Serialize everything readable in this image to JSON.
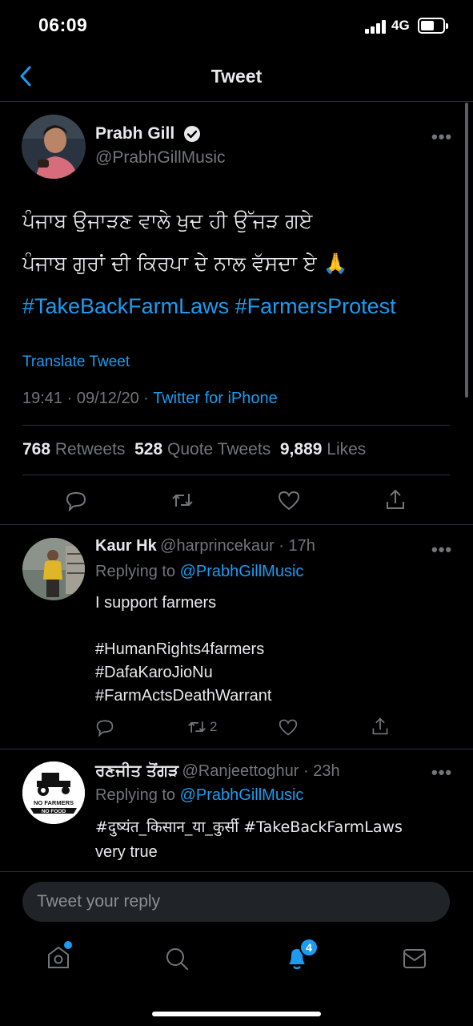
{
  "status_bar": {
    "time": "06:09",
    "network": "4G",
    "battery_level": 0.62
  },
  "header": {
    "title": "Tweet",
    "back_icon": "chevron-left-icon"
  },
  "tweet": {
    "author_name": "Prabh Gill",
    "verified": true,
    "handle": "@PrabhGillMusic",
    "text_line1": "ਪੰਜਾਬ ਉਜਾੜਣ ਵਾਲੇ ਖੁਦ ਹੀ ਉੱਜੜ ਗਏ",
    "text_line2": "ਪੰਜਾਬ ਗੁਰਾਂ ਦੀ ਕਿਰਪਾ ਦੇ ਨਾਲ ਵੱਸਦਾ ਏ",
    "emoji": "🙏",
    "hashtags": "#TakeBackFarmLaws #FarmersProtest",
    "translate_label": "Translate Tweet",
    "time": "19:41",
    "date": "09/12/20",
    "source": "Twitter for iPhone",
    "retweets_count": "768",
    "retweets_label": "Retweets",
    "quotes_count": "528",
    "quotes_label": "Quote Tweets",
    "likes_count": "9,889",
    "likes_label": "Likes"
  },
  "replies": [
    {
      "name": "Kaur Hk",
      "handle": "@harprincekaur",
      "time": "17h",
      "replying_prefix": "Replying to",
      "replying_to": "@PrabhGillMusic",
      "text": "I support farmers",
      "hashtags": [
        "#HumanRights4farmers",
        "#DafaKaroJioNu",
        "#FarmActsDeathWarrant"
      ],
      "retweet_count": "2"
    },
    {
      "name": "ਰਣਜੀਤ ਤੋਂਗੜ",
      "handle": "@Ranjeettoghur",
      "time": "23h",
      "replying_prefix": "Replying to",
      "replying_to": "@PrabhGillMusic",
      "hashtags_line": "#दुष्यंत_किसान_या_कुर्सी #TakeBackFarmLaws",
      "text": "very true",
      "avatar_text_1": "NO FARMERS",
      "avatar_text_2": "NO FOOD"
    }
  ],
  "compose": {
    "placeholder": "Tweet your reply"
  },
  "tab_bar": {
    "notifications_badge": "4"
  },
  "colors": {
    "accent": "#1d9bf0",
    "muted": "#71767b",
    "background": "#000000"
  }
}
